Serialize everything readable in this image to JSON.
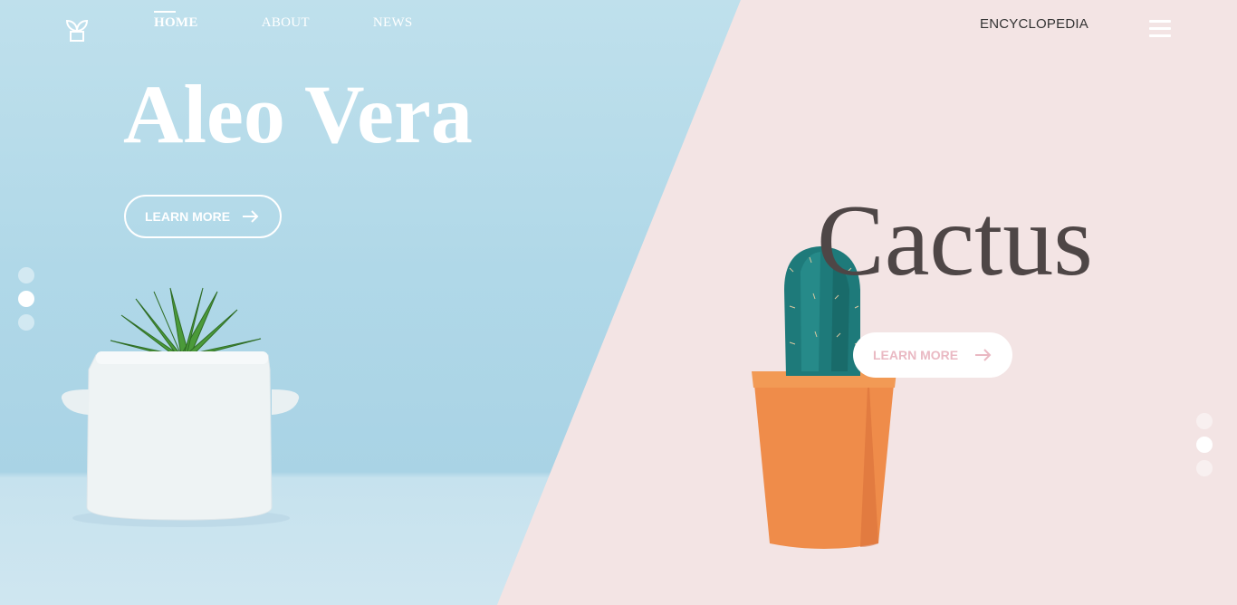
{
  "nav": {
    "items": [
      {
        "label": "HOME",
        "active": true
      },
      {
        "label": "ABOUT",
        "active": false
      },
      {
        "label": "NEWS",
        "active": false
      }
    ],
    "encyclopedia": "ENCYCLOPEDIA"
  },
  "hero_left": {
    "title": "Aleo Vera",
    "button_label": "LEARN MORE"
  },
  "hero_right": {
    "title": "Cactus",
    "button_label": "LEARN MORE"
  },
  "slider_left": {
    "count": 3,
    "active_index": 1
  },
  "slider_right": {
    "count": 3,
    "active_index": 1
  },
  "colors": {
    "left_bg": "#b0d8e8",
    "right_bg": "#f3e4e4",
    "cactus_title": "#4e4646",
    "button_right_text": "#eab9c3"
  },
  "icons": [
    "plant-logo-icon",
    "menu-icon",
    "arrow-right-icon"
  ]
}
